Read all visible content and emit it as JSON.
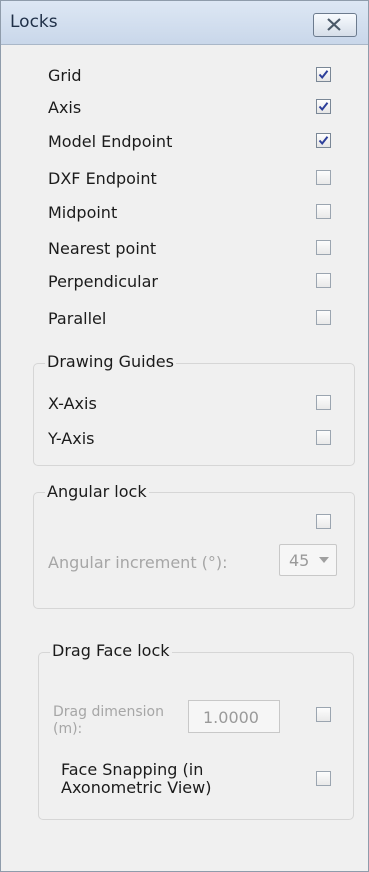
{
  "title": "Locks",
  "locks": [
    {
      "label": "Grid",
      "checked": true
    },
    {
      "label": "Axis",
      "checked": true
    },
    {
      "label": "Model Endpoint",
      "checked": true
    },
    {
      "label": "DXF Endpoint",
      "checked": false
    },
    {
      "label": "Midpoint",
      "checked": false
    },
    {
      "label": "Nearest point",
      "checked": false
    },
    {
      "label": "Perpendicular",
      "checked": false
    },
    {
      "label": "Parallel",
      "checked": false
    }
  ],
  "drawing_guides": {
    "legend": "Drawing Guides",
    "items": [
      {
        "label": "X-Axis",
        "checked": false
      },
      {
        "label": "Y-Axis",
        "checked": false
      }
    ]
  },
  "angular_lock": {
    "legend": "Angular lock",
    "checked": false,
    "increment_label": "Angular increment (°):",
    "increment_value": "45"
  },
  "drag_face_lock": {
    "legend": "Drag Face lock",
    "dimension_label_line1": "Drag dimension",
    "dimension_label_line2": "(m):",
    "dimension_value": "1.0000",
    "dimension_checked": false,
    "face_snapping_line1": "Face Snapping (in",
    "face_snapping_line2": "Axonometric View)",
    "face_snapping_checked": false
  }
}
